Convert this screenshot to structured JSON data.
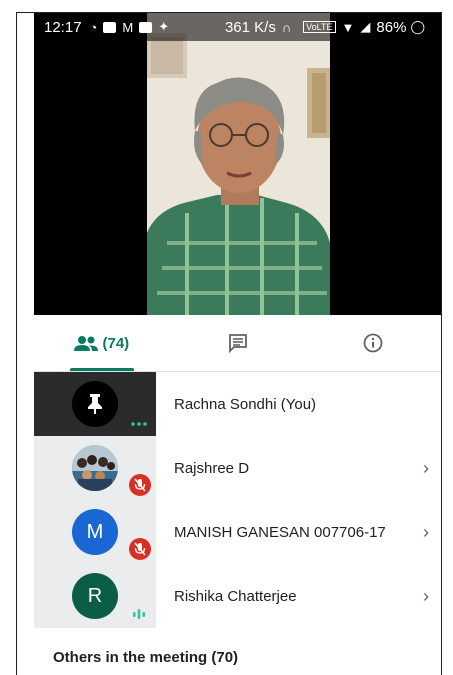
{
  "status_bar": {
    "time": "12:17",
    "net_speed": "361 K/s",
    "volte": "VoLTE",
    "battery": "86%"
  },
  "tabs": [
    {
      "name": "people",
      "label": "(74)",
      "icon": "people-icon",
      "active": true
    },
    {
      "name": "chat",
      "label": "",
      "icon": "chat-icon",
      "active": false
    },
    {
      "name": "info",
      "label": "",
      "icon": "info-icon",
      "active": false
    }
  ],
  "participants": [
    {
      "name": "Rachna Sondhi (You)",
      "avatar_type": "pin",
      "status": "more"
    },
    {
      "name": "Rajshree D",
      "avatar_type": "photo",
      "status": "muted"
    },
    {
      "name": "MANISH GANESAN 007706-17",
      "avatar_type": "letter",
      "letter": "M",
      "avatar_color": "#1967d2",
      "status": "muted"
    },
    {
      "name": "Rishika Chatterjee",
      "avatar_type": "letter",
      "letter": "R",
      "avatar_color": "#0b5e45",
      "status": "speaking"
    }
  ],
  "others_title": "Others in the meeting (70)",
  "colors": {
    "accent": "#0b7a62",
    "mute_red": "#d93025"
  }
}
